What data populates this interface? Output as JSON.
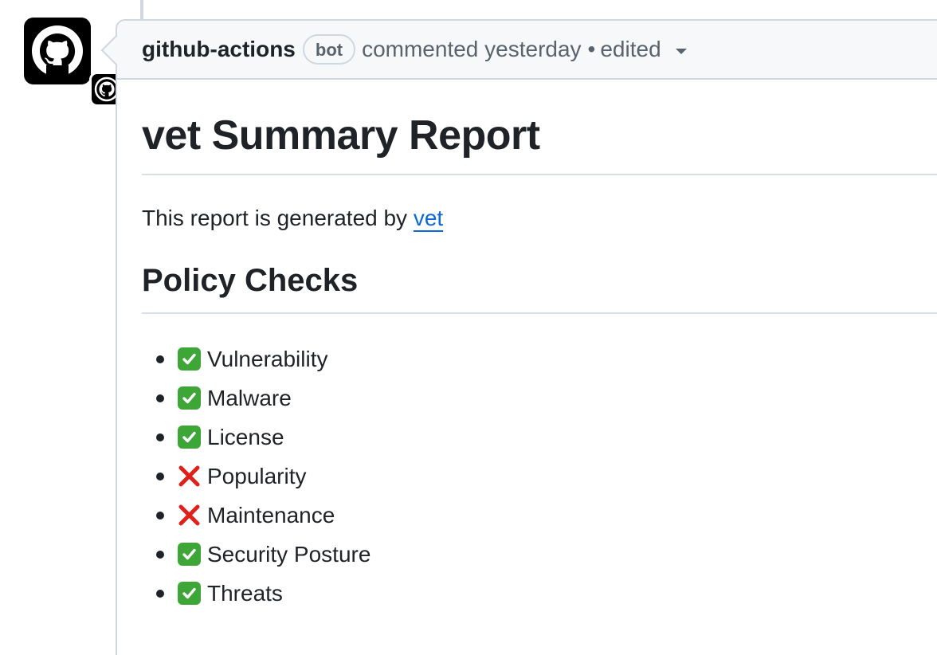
{
  "comment": {
    "author": "github-actions",
    "badge": "bot",
    "action": "commented yesterday",
    "separator": "•",
    "edited": "edited"
  },
  "report": {
    "title": "vet Summary Report",
    "intro_text": "This report is generated by ",
    "intro_link": "vet",
    "section_title": "Policy Checks",
    "checks": [
      {
        "label": "Vulnerability",
        "status": "pass",
        "icon": "check-mark-icon"
      },
      {
        "label": "Malware",
        "status": "pass",
        "icon": "check-mark-icon"
      },
      {
        "label": "License",
        "status": "pass",
        "icon": "check-mark-icon"
      },
      {
        "label": "Popularity",
        "status": "fail",
        "icon": "cross-mark-icon"
      },
      {
        "label": "Maintenance",
        "status": "fail",
        "icon": "cross-mark-icon"
      },
      {
        "label": "Security Posture",
        "status": "pass",
        "icon": "check-mark-icon"
      },
      {
        "label": "Threats",
        "status": "pass",
        "icon": "check-mark-icon"
      }
    ]
  },
  "colors": {
    "pass": "#3da637",
    "fail": "#e0201b",
    "link": "#0969da"
  }
}
